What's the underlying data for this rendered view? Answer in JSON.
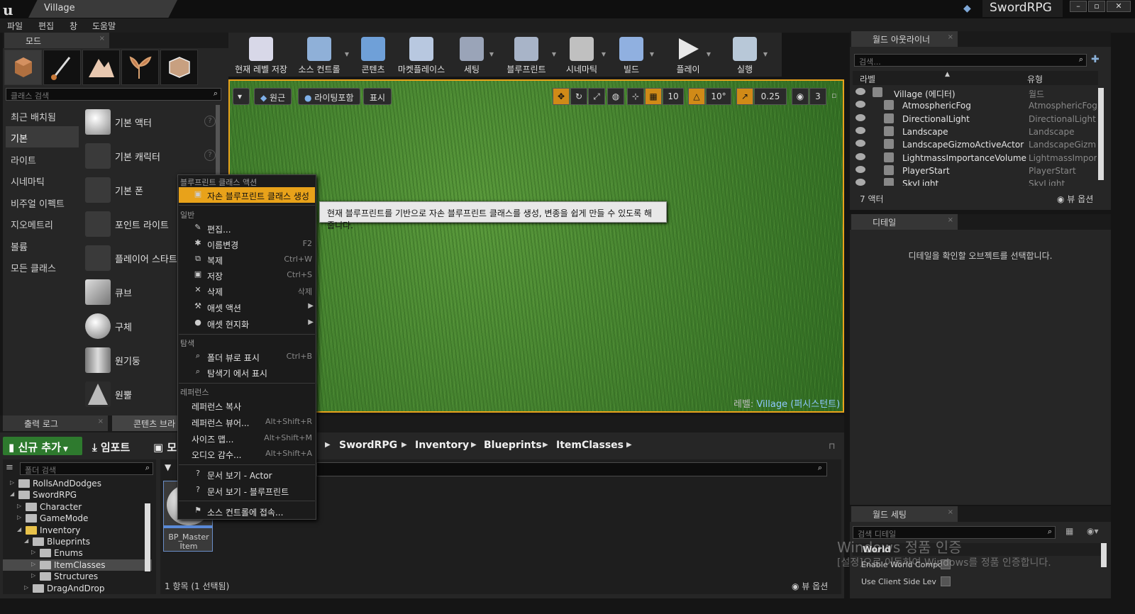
{
  "window": {
    "doc_tab": "Village",
    "project_name": "SwordRPG",
    "buttons": [
      "–",
      "▫",
      "✕"
    ]
  },
  "menu": [
    "파일",
    "편집",
    "창",
    "도움말"
  ],
  "modes": {
    "tab": "모드",
    "search_placeholder": "클래스 검색",
    "categories": [
      "최근 배치됨",
      "기본",
      "라이트",
      "시네마틱",
      "비주얼 이펙트",
      "지오메트리",
      "볼륨",
      "모든 클래스"
    ],
    "selected_category": "기본",
    "placeables": [
      "기본 액터",
      "기본 캐릭터",
      "기본 폰",
      "포인트 라이트",
      "플레이어 스타트",
      "큐브",
      "구체",
      "원기둥",
      "원뿔"
    ]
  },
  "toolbar": [
    {
      "label": "현재 레벨 저장",
      "color": "#d8d8e8"
    },
    {
      "label": "소스 컨트롤",
      "color": "#8fb0d8"
    },
    {
      "label": "콘텐츠",
      "color": "#6fa0d8"
    },
    {
      "label": "마켓플레이스",
      "color": "#b8c8e0"
    },
    {
      "label": "세팅",
      "color": "#9aa4b8"
    },
    {
      "label": "블루프린트",
      "color": "#a8b4c8"
    },
    {
      "label": "시네마틱",
      "color": "#c0c0c0"
    },
    {
      "label": "빌드",
      "color": "#90b0e0"
    },
    {
      "label": "플레이",
      "color": "#e8e8e8"
    },
    {
      "label": "실행",
      "color": "#b8c8d8"
    }
  ],
  "viewport": {
    "buttons": [
      "원근",
      "라이팅포함",
      "표시"
    ],
    "snap_values": [
      "10",
      "10°",
      "0.25",
      "3"
    ],
    "level_label": "레벨:",
    "level_name": "Village (퍼시스턴트)"
  },
  "context_menu": {
    "section_blueprint": "블루프린트 클래스 액션",
    "create_child": "자손 블루프린트 클래스 생성",
    "section_general": "일반",
    "general_items": [
      {
        "label": "편집...",
        "shortcut": ""
      },
      {
        "label": "이름변경",
        "shortcut": "F2"
      },
      {
        "label": "복제",
        "shortcut": "Ctrl+W"
      },
      {
        "label": "저장",
        "shortcut": "Ctrl+S"
      },
      {
        "label": "삭제",
        "shortcut": "삭제"
      },
      {
        "label": "애셋 액션",
        "shortcut": ""
      },
      {
        "label": "애셋 현지화",
        "shortcut": ""
      }
    ],
    "section_explore": "탐색",
    "explore_items": [
      {
        "label": "폴더 뷰로 표시",
        "shortcut": "Ctrl+B"
      },
      {
        "label": "탐색기 에서 표시",
        "shortcut": ""
      }
    ],
    "section_refs": "레퍼런스",
    "ref_items": [
      {
        "label": "레퍼런스 복사",
        "shortcut": ""
      },
      {
        "label": "레퍼런스 뷰어...",
        "shortcut": "Alt+Shift+R"
      },
      {
        "label": "사이즈 맵...",
        "shortcut": "Alt+Shift+M"
      },
      {
        "label": "오디오 감수...",
        "shortcut": "Alt+Shift+A"
      }
    ],
    "doc_items": [
      "문서 보기 - Actor",
      "문서 보기 - 블루프린트"
    ],
    "source_control": "소스 컨트롤에 접속..."
  },
  "tooltip": "현재 블루프린트를 기반으로 자손 블루프린트 클래스를 생성, 변종을 쉽게 만들 수 있도록 해줍니다.",
  "bottom": {
    "tab_output": "출력 로그",
    "tab_content": "콘텐츠 브라",
    "add_new": "신규 추가",
    "import": "임포트",
    "save_partial": "모",
    "breadcrumbs": [
      "SwordRPG",
      "Inventory",
      "Blueprints",
      "ItemClasses"
    ],
    "folder_search_placeholder": "폴더 검색",
    "tree": [
      {
        "label": "RollsAndDodges",
        "indent": 1,
        "open": false
      },
      {
        "label": "SwordRPG",
        "indent": 1,
        "open": true
      },
      {
        "label": "Character",
        "indent": 2,
        "open": false
      },
      {
        "label": "GameMode",
        "indent": 2,
        "open": false
      },
      {
        "label": "Inventory",
        "indent": 2,
        "open": true
      },
      {
        "label": "Blueprints",
        "indent": 3,
        "open": true
      },
      {
        "label": "Enums",
        "indent": 4,
        "open": false
      },
      {
        "label": "ItemClasses",
        "indent": 4,
        "open": false
      },
      {
        "label": "Structures",
        "indent": 4,
        "open": false
      },
      {
        "label": "DragAndDrop",
        "indent": 3,
        "open": false
      }
    ],
    "asset_label": "BP_Master Item",
    "status": "1 항목 (1 선택됨)",
    "view_options": "뷰 옵션"
  },
  "outliner": {
    "tab": "월드 아웃라이너",
    "search_placeholder": "검색...",
    "col_label": "라벨",
    "col_type": "유형",
    "rows": [
      {
        "name": "Village (에디터)",
        "type": "월드"
      },
      {
        "name": "AtmosphericFog",
        "type": "AtmosphericFog"
      },
      {
        "name": "DirectionalLight",
        "type": "DirectionalLight"
      },
      {
        "name": "Landscape",
        "type": "Landscape"
      },
      {
        "name": "LandscapeGizmoActiveActor",
        "type": "LandscapeGizm"
      },
      {
        "name": "LightmassImportanceVolume",
        "type": "LightmassImpor"
      },
      {
        "name": "PlayerStart",
        "type": "PlayerStart"
      },
      {
        "name": "SkyLight",
        "type": "SkyLight"
      }
    ],
    "count": "7 액터",
    "view_options": "뷰 옵션"
  },
  "details": {
    "tab": "디테일",
    "message": "디테일을 확인할 오브젝트를 선택합니다."
  },
  "world_settings": {
    "tab": "월드 세팅",
    "search_placeholder": "검색 디테일",
    "section": "World",
    "props": [
      "Enable World Compo",
      "Use Client Side Lev"
    ]
  },
  "watermark": {
    "line1": "Windows 정품 인증",
    "line2": "[설정]으로 이동하여 Windows를 정품 인증합니다."
  }
}
